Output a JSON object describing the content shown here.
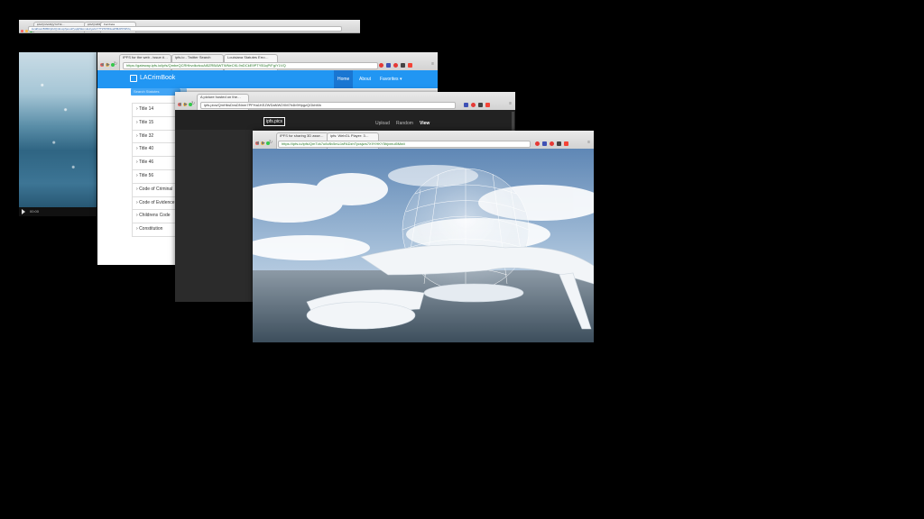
{
  "windows": {
    "w1": {
      "tabs": [
        "ipfs/QmVubQyYoTzk…",
        "ipfs/Qmf6FGwzGg94U…",
        "Fernbeta"
      ],
      "url": "localhost:8080/ipfs/QmbuxpfpouoPyqdpSkomaUcyebxY7TZSTZDuaWMAPKSP2q",
      "player_time": "00:00"
    },
    "w2": {
      "tabs": [
        "IPFS for the web - issue #…",
        "ipfs.io - Twitter Search",
        "Louisiana Statutes Erro…"
      ],
      "url": "https://gateway.ipfs.io/ipfs/QmbeQCRHbvdkvtcuAt5ZRBAWTWNeCKL9nDCkE9PTYB1qP/Fg/Y1VQ",
      "brand": "LACrimBook",
      "nav": [
        "Home",
        "About",
        "Favorites ▾"
      ],
      "search_placeholder": "Search Statutes",
      "items": [
        "Title 14",
        "Title 15",
        "Title 32",
        "Title 40",
        "Title 46",
        "Title 56",
        "Code of Criminal",
        "Code of Evidence",
        "Childrens Code",
        "Constitution"
      ]
    },
    "w3": {
      "tabs": [
        "A picture hosted on the…"
      ],
      "url": "ipfs.pics/QmHbsDvsDNnm7PFHa1KEZWDaNW2XM7h4b9HpgzQGkhMn",
      "logo": "ipfs.pics",
      "nav": [
        "Upload",
        "Random",
        "View"
      ]
    },
    "w4": {
      "tabs": [
        "IPFS for sharing 3D asse…",
        "ipfs: WebGL Player: 3…"
      ],
      "url": "https://ipfs.io/ipfs/QmTzk7u6vBv5eUJaFADzhTycsjws7X9YHKY5hjvmui5Mw/i"
    }
  },
  "colors": {
    "brand_blue": "#2196f3",
    "nav_active": "#1976d2",
    "dark_page": "#2b2b2b",
    "url_green": "#2a7a2a"
  }
}
